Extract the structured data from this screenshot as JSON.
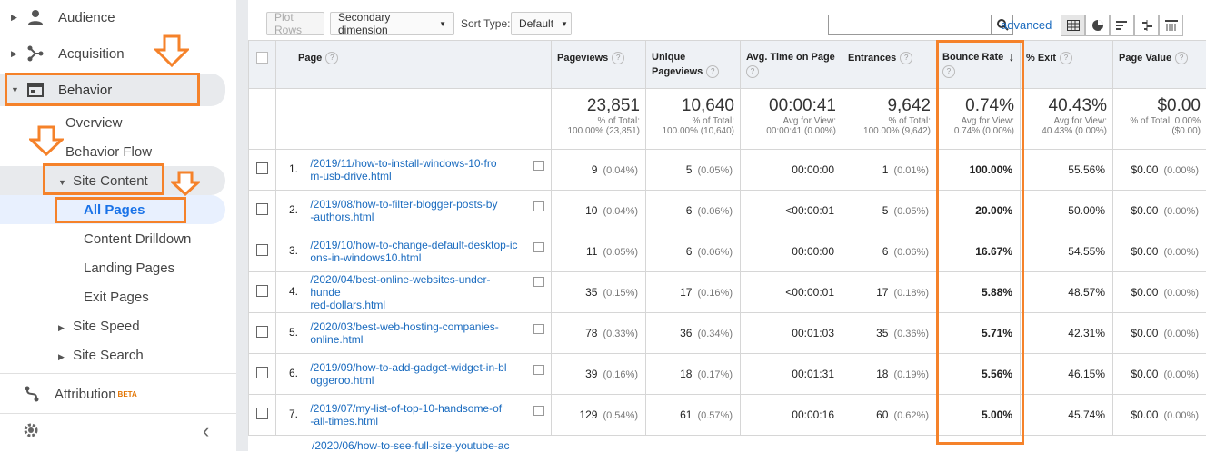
{
  "sidebar": {
    "audience": "Audience",
    "acquisition": "Acquisition",
    "behavior": "Behavior",
    "overview": "Overview",
    "behavior_flow": "Behavior Flow",
    "site_content": "Site Content",
    "all_pages": "All Pages",
    "content_drilldown": "Content Drilldown",
    "landing_pages": "Landing Pages",
    "exit_pages": "Exit Pages",
    "site_speed": "Site Speed",
    "site_search": "Site Search",
    "attribution": "Attribution",
    "beta": "BETA",
    "collapse_glyph": "‹"
  },
  "toolbar": {
    "plot_rows": "Plot Rows",
    "secondary_dimension": "Secondary dimension",
    "sort_type_label": "Sort Type:",
    "sort_type_value": "Default",
    "advanced": "advanced"
  },
  "table": {
    "headers": {
      "page": "Page",
      "pageviews": "Pageviews",
      "unique_pageviews": "Unique Pageviews",
      "avg_time": "Avg. Time on Page",
      "entrances": "Entrances",
      "bounce_rate": "Bounce Rate",
      "exit": "% Exit",
      "page_value": "Page Value"
    },
    "totals": {
      "pageviews": "23,851",
      "pageviews_sub1": "% of Total:",
      "pageviews_sub2": "100.00% (23,851)",
      "unique": "10,640",
      "unique_sub1": "% of Total:",
      "unique_sub2": "100.00% (10,640)",
      "avg_time": "00:00:41",
      "avg_time_sub1": "Avg for View:",
      "avg_time_sub2": "00:00:41 (0.00%)",
      "entrances": "9,642",
      "entrances_sub1": "% of Total:",
      "entrances_sub2": "100.00% (9,642)",
      "bounce": "0.74%",
      "bounce_sub1": "Avg for View:",
      "bounce_sub2": "0.74% (0.00%)",
      "exit": "40.43%",
      "exit_sub1": "Avg for View:",
      "exit_sub2": "40.43% (0.00%)",
      "value": "$0.00",
      "value_sub1": "% of Total: 0.00%",
      "value_sub2": "($0.00)"
    },
    "rows": [
      {
        "idx": "1.",
        "l1": "/2019/11/how-to-install-windows-10-fro",
        "l2": "m-usb-drive.html",
        "pv": "9",
        "pvp": "(0.04%)",
        "up": "5",
        "upp": "(0.05%)",
        "t": "00:00:00",
        "en": "1",
        "enp": "(0.01%)",
        "br": "100.00%",
        "ex": "55.56%",
        "v": "$0.00",
        "vp": "(0.00%)"
      },
      {
        "idx": "2.",
        "l1": "/2019/08/how-to-filter-blogger-posts-by",
        "l2": "-authors.html",
        "pv": "10",
        "pvp": "(0.04%)",
        "up": "6",
        "upp": "(0.06%)",
        "t": "<00:00:01",
        "en": "5",
        "enp": "(0.05%)",
        "br": "20.00%",
        "ex": "50.00%",
        "v": "$0.00",
        "vp": "(0.00%)"
      },
      {
        "idx": "3.",
        "l1": "/2019/10/how-to-change-default-desktop-ic",
        "l2": "ons-in-windows10.html",
        "pv": "11",
        "pvp": "(0.05%)",
        "up": "6",
        "upp": "(0.06%)",
        "t": "00:00:00",
        "en": "6",
        "enp": "(0.06%)",
        "br": "16.67%",
        "ex": "54.55%",
        "v": "$0.00",
        "vp": "(0.00%)"
      },
      {
        "idx": "4.",
        "l1": "/2020/04/best-online-websites-under-hunde",
        "l2": "red-dollars.html",
        "pv": "35",
        "pvp": "(0.15%)",
        "up": "17",
        "upp": "(0.16%)",
        "t": "<00:00:01",
        "en": "17",
        "enp": "(0.18%)",
        "br": "5.88%",
        "ex": "48.57%",
        "v": "$0.00",
        "vp": "(0.00%)"
      },
      {
        "idx": "5.",
        "l1": "/2020/03/best-web-hosting-companies-",
        "l2": "online.html",
        "pv": "78",
        "pvp": "(0.33%)",
        "up": "36",
        "upp": "(0.34%)",
        "t": "00:01:03",
        "en": "35",
        "enp": "(0.36%)",
        "br": "5.71%",
        "ex": "42.31%",
        "v": "$0.00",
        "vp": "(0.00%)"
      },
      {
        "idx": "6.",
        "l1": "/2019/09/how-to-add-gadget-widget-in-bl",
        "l2": "oggeroo.html",
        "pv": "39",
        "pvp": "(0.16%)",
        "up": "18",
        "upp": "(0.17%)",
        "t": "00:01:31",
        "en": "18",
        "enp": "(0.19%)",
        "br": "5.56%",
        "ex": "46.15%",
        "v": "$0.00",
        "vp": "(0.00%)"
      },
      {
        "idx": "7.",
        "l1": "/2019/07/my-list-of-top-10-handsome-of",
        "l2": "-all-times.html",
        "pv": "129",
        "pvp": "(0.54%)",
        "up": "61",
        "upp": "(0.57%)",
        "t": "00:00:16",
        "en": "60",
        "enp": "(0.62%)",
        "br": "5.00%",
        "ex": "45.74%",
        "v": "$0.00",
        "vp": "(0.00%)"
      }
    ],
    "partial_row": "/2020/06/how-to-see-full-size-youtube-ac"
  },
  "colors": {
    "accent_orange": "#f5822a",
    "link_blue": "#1a6bbf"
  }
}
